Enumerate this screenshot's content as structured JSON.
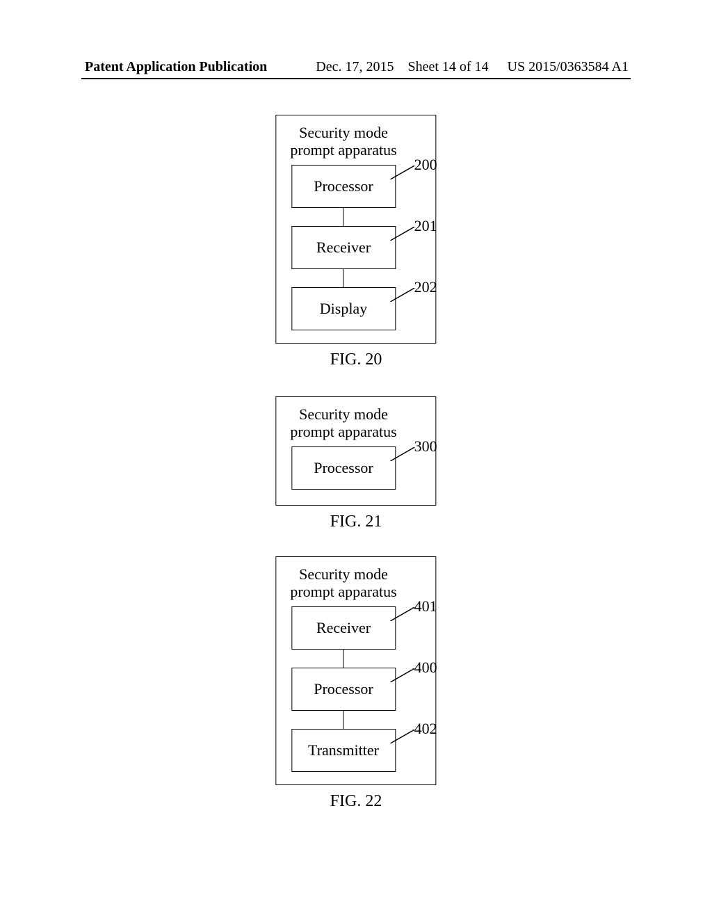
{
  "header": {
    "left": "Patent Application Publication",
    "date": "Dec. 17, 2015",
    "sheet": "Sheet 14 of 14",
    "pubno": "US 2015/0363584 A1"
  },
  "fig20": {
    "title1": "Security mode",
    "title2": "prompt apparatus",
    "boxes": [
      {
        "label": "Processor",
        "ref": "200"
      },
      {
        "label": "Receiver",
        "ref": "201"
      },
      {
        "label": "Display",
        "ref": "202"
      }
    ],
    "caption": "FIG. 20"
  },
  "fig21": {
    "title1": "Security mode",
    "title2": "prompt apparatus",
    "boxes": [
      {
        "label": "Processor",
        "ref": "300"
      }
    ],
    "caption": "FIG. 21"
  },
  "fig22": {
    "title1": "Security mode",
    "title2": "prompt apparatus",
    "boxes": [
      {
        "label": "Receiver",
        "ref": "401"
      },
      {
        "label": "Processor",
        "ref": "400"
      },
      {
        "label": "Transmitter",
        "ref": "402"
      }
    ],
    "caption": "FIG. 22"
  }
}
